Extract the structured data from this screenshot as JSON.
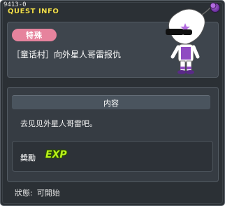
{
  "window": {
    "quest_id": "9413-0",
    "title": "QUEST INFO"
  },
  "quest": {
    "badge": "特殊",
    "name": "［童话村］向外星人哥雷报仇"
  },
  "content": {
    "header": "内容",
    "text": "去见见外星人哥雷吧。"
  },
  "reward": {
    "label": "奬勵",
    "type": "EXP"
  },
  "status": {
    "label": "狀態:",
    "value": "可開始"
  },
  "colors": {
    "title": "#f0de4a",
    "badge": "#e6839d",
    "exp": "#b9f21a",
    "close": "#8a44c0"
  },
  "icons": {
    "close": "close-icon",
    "character": "alien-character-icon"
  }
}
